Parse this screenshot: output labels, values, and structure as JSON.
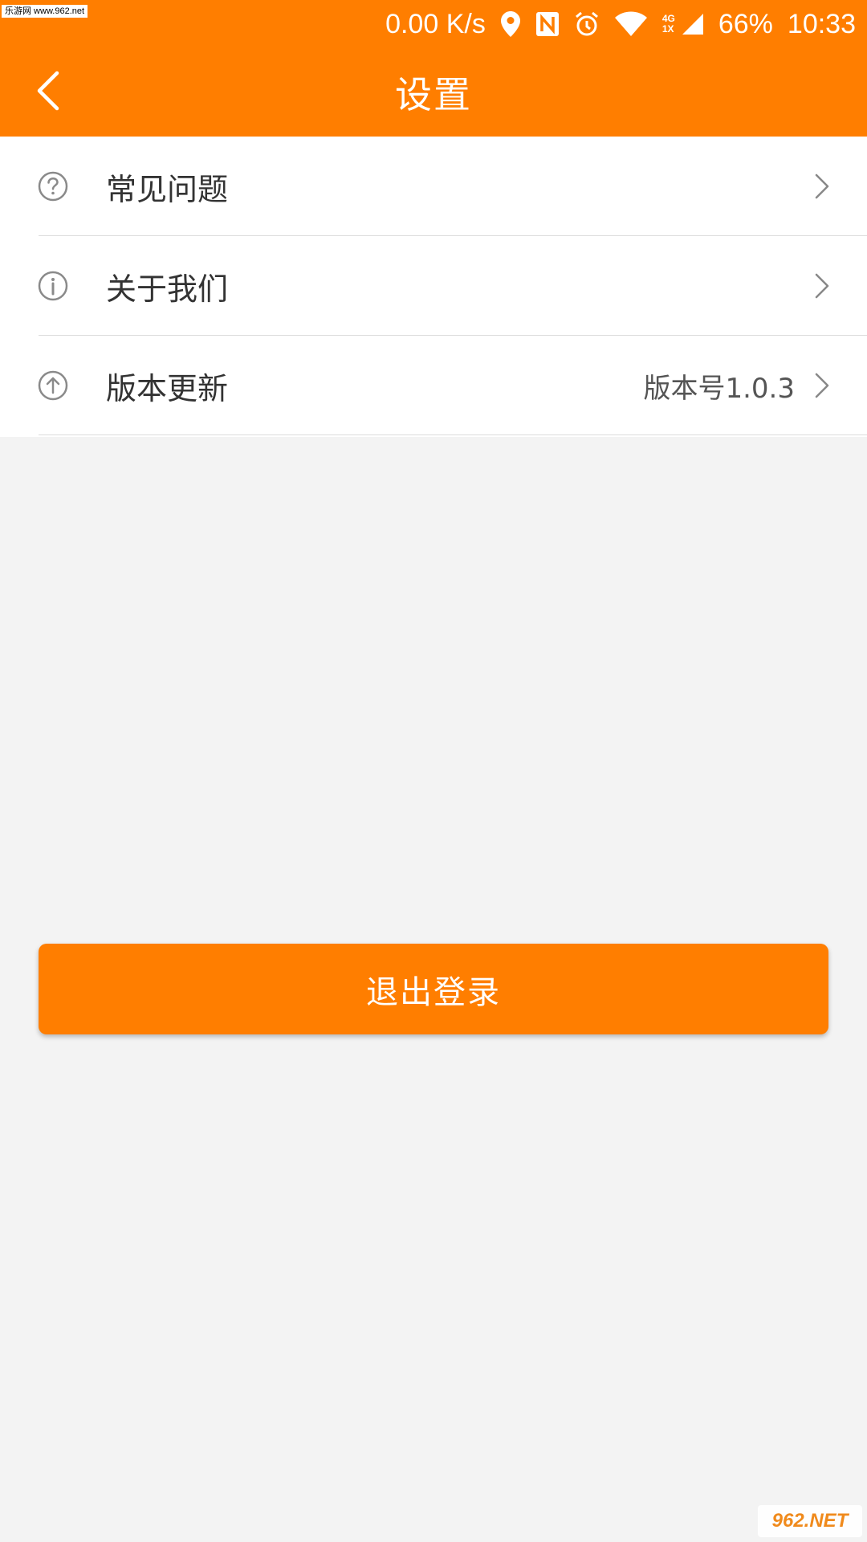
{
  "watermark": {
    "top_left": "乐游网 www.962.net",
    "bottom_right": "962.NET"
  },
  "status_bar": {
    "net_speed": "0.00 K/s",
    "signal_top": "4G",
    "signal_bottom": "1X",
    "battery": "66%",
    "time": "10:33"
  },
  "header": {
    "title": "设置",
    "back_icon": "chevron-left-icon"
  },
  "menu": {
    "items": [
      {
        "label": "常见问题",
        "icon": "question-circle-icon",
        "value": ""
      },
      {
        "label": "关于我们",
        "icon": "info-circle-icon",
        "value": ""
      },
      {
        "label": "版本更新",
        "icon": "arrow-up-circle-icon",
        "value": "版本号1.0.3"
      }
    ]
  },
  "logout": {
    "label": "退出登录"
  },
  "colors": {
    "accent": "#ff7e00",
    "background": "#f3f3f3",
    "text": "#333333"
  }
}
